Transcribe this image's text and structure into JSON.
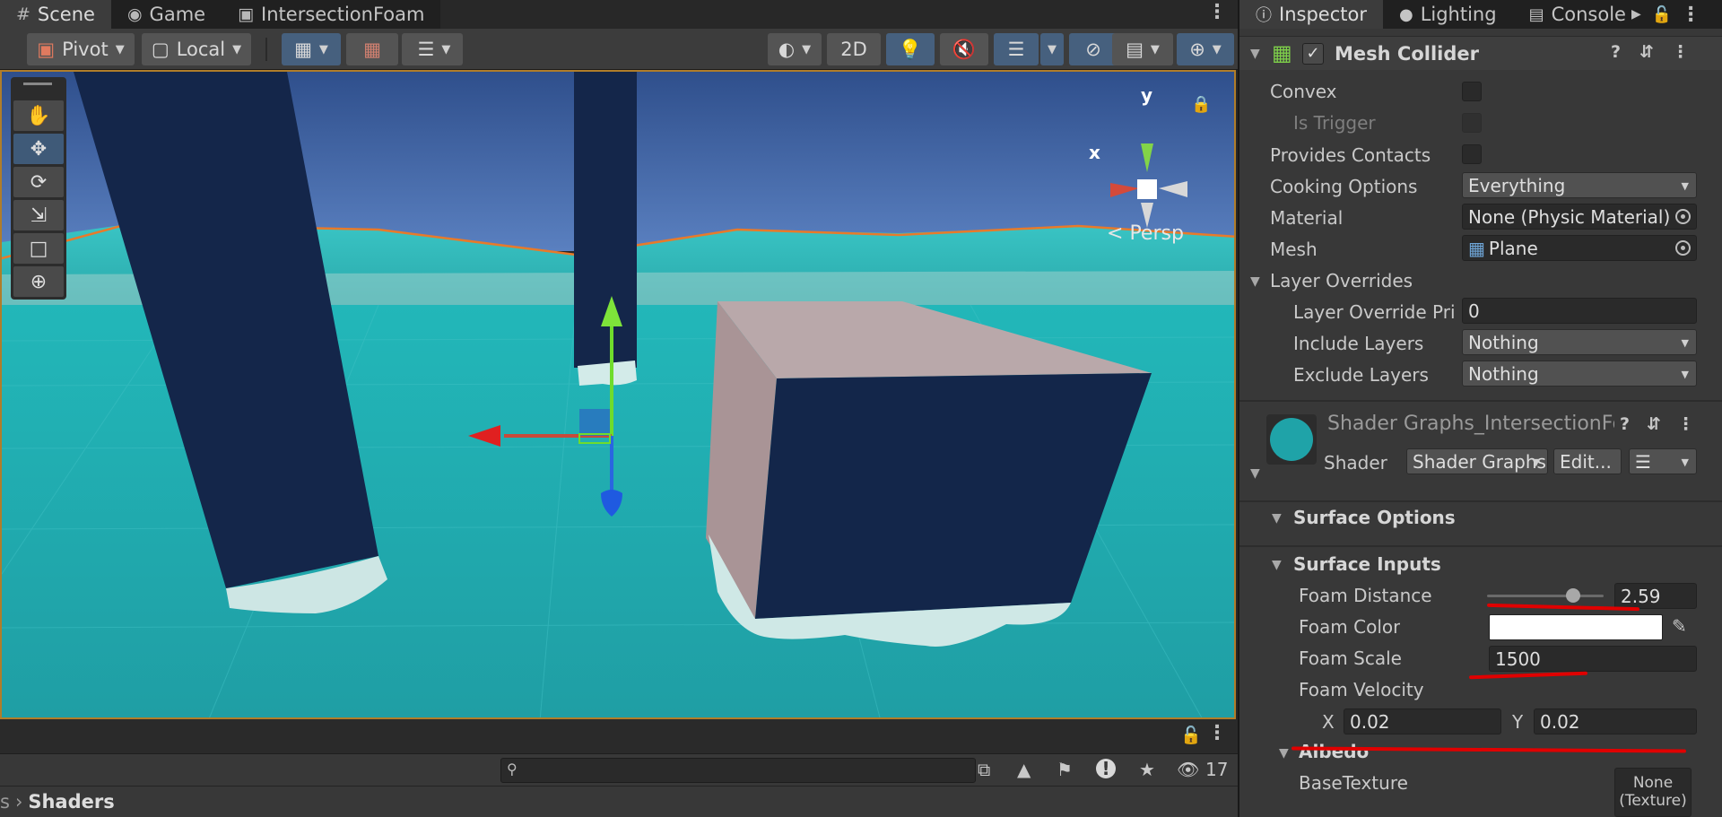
{
  "scene_tabs": [
    {
      "label": "Scene",
      "icon": "grid-icon"
    },
    {
      "label": "Game",
      "icon": "gamepad-icon"
    },
    {
      "label": "IntersectionFoam",
      "icon": "prefab-icon"
    }
  ],
  "toolbar": {
    "pivot_label": "Pivot",
    "local_label": "Local",
    "twod_label": "2D"
  },
  "scene_view": {
    "axis_y_label": "y",
    "axis_x_label": "x",
    "persp_label": "Persp"
  },
  "search": {
    "placeholder": "",
    "visible_count": "17"
  },
  "breadcrumb": {
    "parent": "s",
    "current": "Shaders"
  },
  "inspector_tabs": [
    {
      "label": "Inspector",
      "icon": "info-icon"
    },
    {
      "label": "Lighting",
      "icon": "bulb-icon"
    },
    {
      "label": "Console",
      "icon": "console-icon"
    }
  ],
  "mesh_collider": {
    "title": "Mesh Collider",
    "enabled": true,
    "convex_label": "Convex",
    "is_trigger_label": "Is Trigger",
    "provides_contacts_label": "Provides Contacts",
    "cooking_options_label": "Cooking Options",
    "cooking_options_value": "Everything",
    "material_label": "Material",
    "material_value": "None (Physic Material)",
    "mesh_label": "Mesh",
    "mesh_value": "Plane",
    "layer_overrides_label": "Layer Overrides",
    "layer_override_priority_label": "Layer Override Priority",
    "layer_override_priority_value": "0",
    "include_layers_label": "Include Layers",
    "include_layers_value": "Nothing",
    "exclude_layers_label": "Exclude Layers",
    "exclude_layers_value": "Nothing"
  },
  "material": {
    "title": "Shader Graphs_IntersectionFoam",
    "shader_label": "Shader",
    "shader_value": "Shader Graphs",
    "edit_label": "Edit..."
  },
  "surface_options": {
    "title": "Surface Options"
  },
  "surface_inputs": {
    "title": "Surface Inputs",
    "foam_distance_label": "Foam Distance",
    "foam_distance_value": "2.59",
    "foam_distance_fraction": 0.74,
    "foam_color_label": "Foam Color",
    "foam_color": "#ffffff",
    "foam_scale_label": "Foam Scale",
    "foam_scale_value": "1500",
    "foam_velocity_label": "Foam Velocity",
    "velocity_x_label": "X",
    "velocity_x_value": "0.02",
    "velocity_y_label": "Y",
    "velocity_y_value": "0.02"
  },
  "albedo": {
    "title": "Albedo",
    "base_texture_label": "BaseTexture",
    "base_texture_value_line1": "None",
    "base_texture_value_line2": "(Texture)"
  },
  "colors": {
    "accent_blue": "#46607e",
    "selection_outline": "#b07d2a",
    "annotation_red": "#e00000",
    "water": "#1fa3a8",
    "sky": "#4a6fb0"
  }
}
